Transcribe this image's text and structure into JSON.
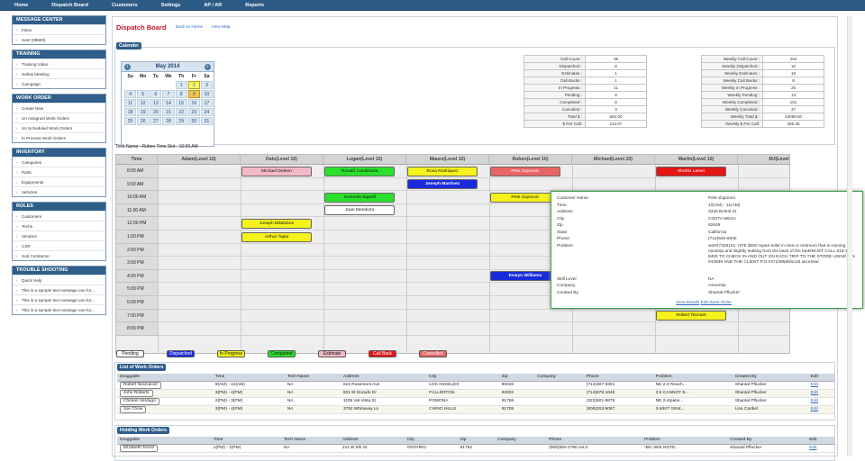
{
  "nav": {
    "items": [
      "Home",
      "Dispatch Board",
      "Customers",
      "Settings",
      "AP / AR",
      "Reports"
    ]
  },
  "sidebar": {
    "sections": [
      {
        "title": "MESSAGE CENTER",
        "items": [
          "Inbox",
          "Sent (38800)"
        ]
      },
      {
        "title": "TRAINING",
        "items": [
          "Training Video",
          "Safety Meeting",
          "Campaign"
        ]
      },
      {
        "title": "WORK ORDER",
        "items": [
          "Create New",
          "Un Assigned Work Orders",
          "Un Scheduled Work Orders",
          "In Process Work Orders"
        ]
      },
      {
        "title": "INVENTORY",
        "items": [
          "Categories",
          "Parts",
          "Equipments",
          "Vehicles"
        ]
      },
      {
        "title": "ROLES",
        "items": [
          "Customers",
          "Techs",
          "Vendors",
          "CSR",
          "Sub Contractor"
        ]
      },
      {
        "title": "TROUBLE SHOOTING",
        "items": [
          "Quick Help",
          "This is a sample text message one for...",
          "This is a sample text message one for...",
          "This is a sample text message one for..."
        ]
      }
    ]
  },
  "page": {
    "title": "Dispatch Board",
    "links": [
      "Back to Home",
      "View Map"
    ]
  },
  "calendar": {
    "section_title": "Calender",
    "month_label": "May 2014",
    "prev": "‹",
    "next": "›",
    "weekdays": [
      "Su",
      "Mo",
      "Tu",
      "We",
      "Th",
      "Fr",
      "Sa"
    ],
    "weeks": [
      [
        "",
        "",
        "",
        "",
        "1",
        "2",
        "3"
      ],
      [
        "4",
        "5",
        "6",
        "7",
        "8",
        "9",
        "10"
      ],
      [
        "11",
        "12",
        "13",
        "14",
        "15",
        "16",
        "17"
      ],
      [
        "18",
        "19",
        "20",
        "21",
        "22",
        "23",
        "24"
      ],
      [
        "25",
        "26",
        "27",
        "28",
        "29",
        "30",
        "31"
      ]
    ],
    "selected_day": "2",
    "today_day": "9"
  },
  "daily_stats": [
    [
      "Call Count :",
      "36"
    ],
    [
      "Dispatched :",
      "8"
    ],
    [
      "Estimates :",
      "1"
    ],
    [
      "Call Backs :",
      "1"
    ],
    [
      "In Progress :",
      "11"
    ],
    [
      "Pending :",
      "8"
    ],
    [
      "Completed :",
      "8"
    ],
    [
      "Canceled :",
      "3"
    ],
    [
      "Total $ :",
      "682.00"
    ],
    [
      "$ Per Call:",
      "113.67"
    ]
  ],
  "weekly_stats": [
    [
      "Weekly Call Count :",
      "262"
    ],
    [
      "Weekly Dispatched :",
      "10"
    ],
    [
      "Weekly Estimates :",
      "18"
    ],
    [
      "Weekly Call Backs :",
      "8"
    ],
    [
      "Weekly In Progress :",
      "25"
    ],
    [
      "Weekly Pending :",
      "13"
    ],
    [
      "Weekly Completed :",
      "151"
    ],
    [
      "Weekly Canceled :",
      "37"
    ],
    [
      "Weekly Total $ :",
      "43089.50"
    ],
    [
      "Weekly $ Per Call:",
      "285.35"
    ]
  ],
  "tech_line": "Tech Name : Ruben Time Slot : 10:00 AM",
  "schedule": {
    "time_header": "Time",
    "techs": [
      "Adam(Level 10)",
      "Dale(Level 10)",
      "Logan(Level 10)",
      "Mauro(Level 10)",
      "Ruben(Level 10)",
      "Michael(Level 10)",
      "Martin(Level 10)",
      "MJ(Level"
    ],
    "times": [
      "8:00 AM",
      "9:00 AM",
      "10:00 AM",
      "11:00 AM",
      "12:00 PM",
      "1:00 PM",
      "2:00 PM",
      "3:00 PM",
      "4:00 PM",
      "5:00 PM",
      "6:00 PM",
      "7:00 PM",
      "8:00 PM"
    ],
    "events": [
      {
        "label": "Michael Deleon",
        "col": 1,
        "row": 0,
        "status": "Estimate",
        "color": "#f4b8c6"
      },
      {
        "label": "Ronald Candelaria",
        "col": 2,
        "row": 0,
        "status": "Completed",
        "color": "#2be02b"
      },
      {
        "label": "Rosa Rodriquez",
        "col": 3,
        "row": 0,
        "status": "In Progress",
        "color": "#f6f21b"
      },
      {
        "label": "Pete Zuponcic",
        "col": 4,
        "row": 0,
        "status": "Cancelled",
        "color": "#e96464"
      },
      {
        "label": "Shahin Lamei",
        "col": 6,
        "row": 0,
        "status": "Call Back",
        "color": "#e51616"
      },
      {
        "label": "Joseph Martinez",
        "col": 3,
        "row": 1,
        "status": "Dispatched",
        "color": "#1a2bdc"
      },
      {
        "label": "Jeremiah Bignell",
        "col": 2,
        "row": 2,
        "status": "Completed",
        "color": "#2be02b"
      },
      {
        "label": "Pete Zuponcic",
        "col": 4,
        "row": 2,
        "status": "In Progress",
        "color": "#f6f21b"
      },
      {
        "label": "Juan Mendoza",
        "col": 2,
        "row": 3,
        "status": "Pending",
        "color": "#ffffff"
      },
      {
        "label": "Joseph Billalobos",
        "col": 1,
        "row": 4,
        "status": "In Progress",
        "color": "#f6f21b"
      },
      {
        "label": "Arthur Tapia",
        "col": 1,
        "row": 5,
        "status": "In Progress",
        "color": "#f6f21b"
      },
      {
        "label": "Evwyn Williams",
        "col": 4,
        "row": 8,
        "status": "Dispatched",
        "color": "#1a2bdc"
      },
      {
        "label": "Robert Tennant",
        "col": 6,
        "row": 10,
        "status": "In Progress",
        "color": "#f6f21b"
      },
      {
        "label": "Robert Tennant",
        "col": 6,
        "row": 11,
        "status": "In Progress",
        "color": "#f6f21b"
      }
    ]
  },
  "popup": {
    "fields": [
      [
        "Customer Name",
        "Pete Zuponcic"
      ],
      [
        "Time",
        "10(AM) - 11(AM)"
      ],
      [
        "Address",
        "3333 Bristol St"
      ],
      [
        "City",
        "COSTA MESA"
      ],
      [
        "Zip",
        "92626"
      ],
      [
        "State",
        "California"
      ],
      [
        "Phone",
        "(714)540-6830"
      ],
      [
        "Problem",
        "wo#47329101- NTE $350 repair toilet in men=s restroom that is running nonstop and slightly leaking from the back of the tank/MUST CALL 818-394-8400 TO CHECK IN AND OUT ON EACH TRIP TO THE STORE USING PIN #43939 AND THE CLIENT P.O.#47239590/scott ascentia/"
      ],
      [
        "Skill Level",
        "NA"
      ],
      [
        "Company",
        "Ascentia/"
      ],
      [
        "Created By",
        "Shantal Pflucker"
      ]
    ],
    "links": [
      "View Details",
      "Edit Work Order"
    ]
  },
  "legend": [
    {
      "label": "Pending",
      "color": "#ffffff",
      "text": "#111"
    },
    {
      "label": "Dispatched",
      "color": "#1a2bdc",
      "text": "#fff"
    },
    {
      "label": "In Progress",
      "color": "#f6f21b",
      "text": "#111"
    },
    {
      "label": "Completed",
      "color": "#2be02b",
      "text": "#111"
    },
    {
      "label": "Estimate",
      "color": "#f4b8c6",
      "text": "#111"
    },
    {
      "label": "Call Back",
      "color": "#e51616",
      "text": "#fff"
    },
    {
      "label": "Cancelled",
      "color": "#e96464",
      "text": "#fff"
    }
  ],
  "work_orders": {
    "title": "List of Work Orders",
    "columns": [
      "Draggable",
      "Time",
      "Tech Name",
      "Address",
      "City",
      "Zip",
      "Company",
      "Phone",
      "Problem",
      "Created By",
      "Edit"
    ],
    "rows": [
      [
        "Robert Neuruecel",
        "9(AM) - 10(AM)",
        "NA",
        "615 Rosemont Ave",
        "LOS ANGELES",
        "90026",
        "",
        "(714)307-9301",
        "NE 2-4 Reach...",
        "Shantal Pflucker",
        "Edit"
      ],
      [
        "John Roberts",
        "3(PM) - 4(PM)",
        "NA",
        "831 El Dorado Dr",
        "FULLERTON",
        "92832",
        "",
        "(714)879-1648",
        "3-6 CANNOT B...",
        "Shantal Pflucker",
        "Edit"
      ],
      [
        "Chrisan Verdugo",
        "2(PM) - 3(PM)",
        "NA",
        "1105 Val Vista St",
        "POMONA",
        "91768",
        "",
        "(323)501-9879",
        "NE 2-4/patio...",
        "Shantal Pflucker",
        "Edit"
      ],
      [
        "Joe Chow",
        "3(PM) - 4(PM)",
        "NA",
        "3782 Whitaway Ln",
        "CHINO HILLS",
        "91709",
        "",
        "(909)203-9067",
        "3-6/KIT SINK...",
        "Lisa Cardiel",
        "Edit"
      ]
    ]
  },
  "holding_orders": {
    "title": "Holding Work Orders",
    "columns": [
      "Draggable",
      "Time",
      "Tech Name",
      "Address",
      "City",
      "Zip",
      "Company",
      "Phone",
      "Problem",
      "Created By",
      "Edit"
    ],
    "rows": [
      [
        "Elizabeth Torrez",
        "1(PM) - 2(PM)",
        "NA",
        "211 W 5th St",
        "ONTARIO",
        "91762",
        "",
        "(909)592-2760 ext:4",
        "*BG SEE NOTE...",
        "Shantal Pflucker",
        "Edit"
      ]
    ]
  }
}
